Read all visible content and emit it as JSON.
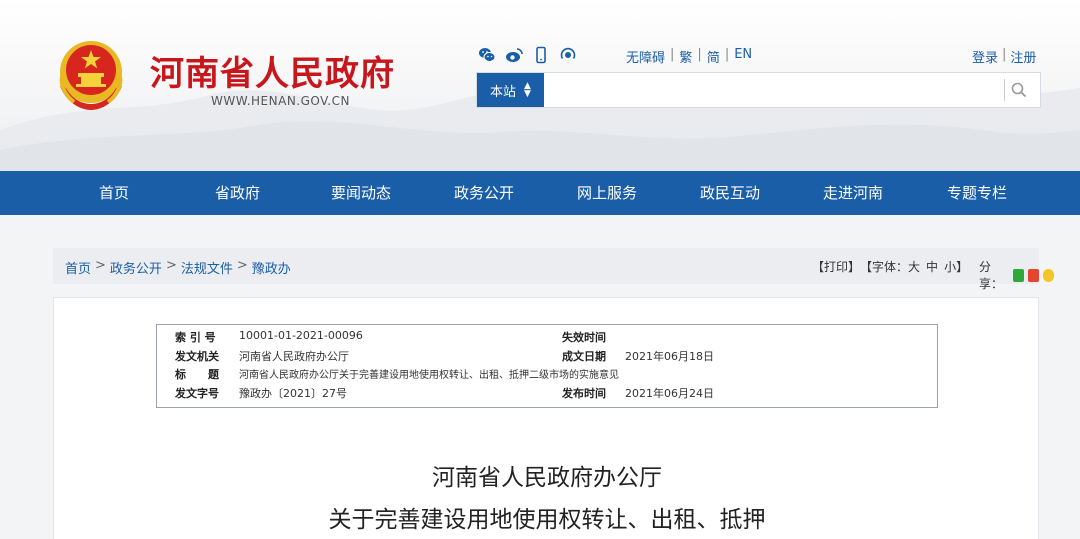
{
  "header": {
    "title": "河南省人民政府",
    "url": "WWW.HENAN.GOV.CN",
    "social_icons": [
      "wechat-icon",
      "weibo-icon",
      "mobile-icon",
      "podcast-icon"
    ],
    "access": {
      "accessible": "无障碍",
      "traditional": "繁",
      "simplified": "简",
      "english": "EN"
    },
    "login": "登录",
    "register": "注册",
    "search": {
      "scope": "本站",
      "placeholder": ""
    }
  },
  "nav": {
    "items": [
      "首页",
      "省政府",
      "要闻动态",
      "政务公开",
      "网上服务",
      "政民互动",
      "走进河南",
      "专题专栏"
    ]
  },
  "breadcrumb": {
    "items": [
      "首页",
      "政务公开",
      "法规文件",
      "豫政办"
    ],
    "sep": ">"
  },
  "tools": {
    "print": "【打印】",
    "font_prefix": "【字体：",
    "large": "大",
    "medium": "中",
    "small": "小",
    "font_suffix": "】",
    "share": "分享："
  },
  "meta": {
    "index_label": "索 引 号",
    "index_value": "10001-01-2021-00096",
    "expire_label": "失效时间",
    "expire_value": "",
    "issuer_label": "发文机关",
    "issuer_value": "河南省人民政府办公厅",
    "created_label": "成文日期",
    "created_value": "2021年06月18日",
    "subject_label": "标　　题",
    "subject_value": "河南省人民政府办公厅关于完善建设用地使用权转让、出租、抵押二级市场的实施意见",
    "docno_label": "发文字号",
    "docno_value": "豫政办〔2021〕27号",
    "publish_label": "发布时间",
    "publish_value": "2021年06月24日"
  },
  "document": {
    "title_line1": "河南省人民政府办公厅",
    "title_line2": "关于完善建设用地使用权转让、出租、抵押"
  },
  "colors": {
    "brand_red": "#c8161d",
    "brand_blue": "#1b5ea8"
  }
}
